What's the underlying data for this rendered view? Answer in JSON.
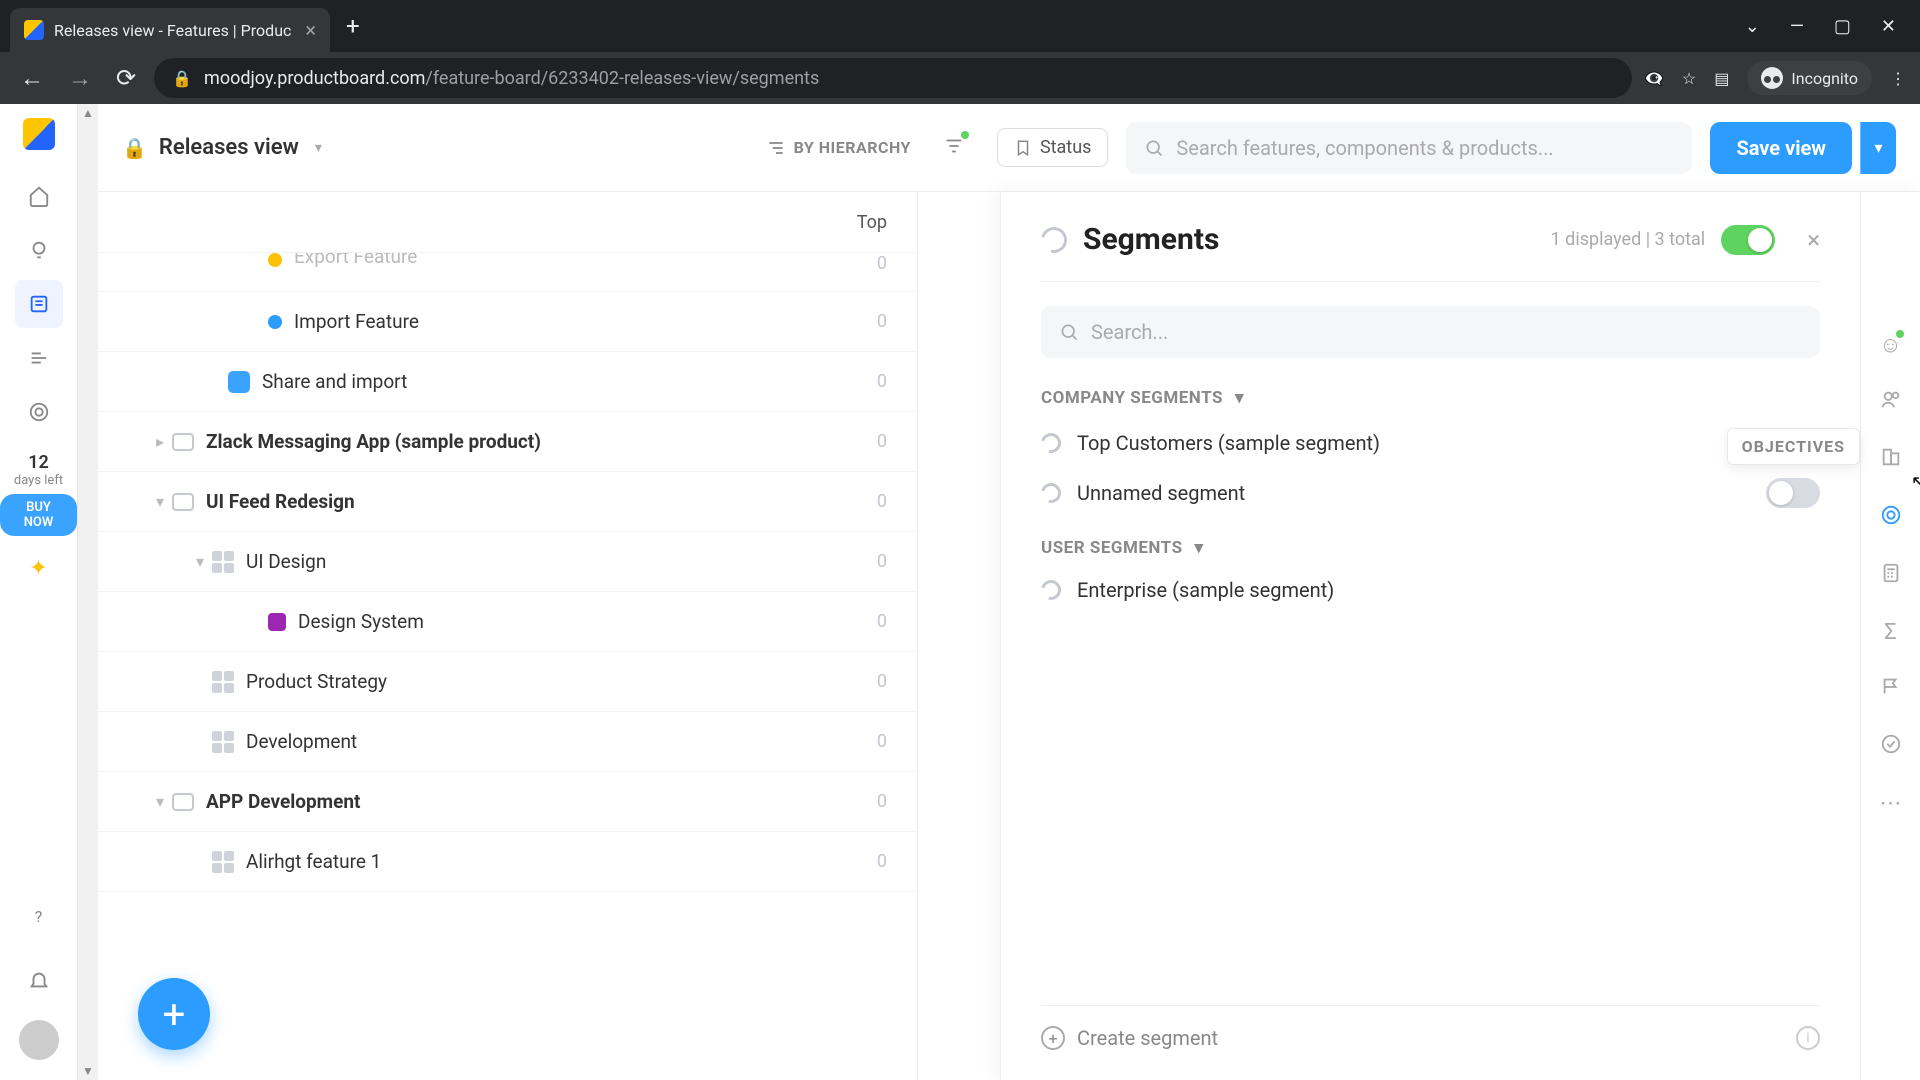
{
  "browser": {
    "tab_title": "Releases view - Features | Produc",
    "url_domain": "moodjoy.productboard.com",
    "url_path": "/feature-board/6233402-releases-view/segments",
    "incognito_label": "Incognito"
  },
  "topbar": {
    "view_name": "Releases view",
    "hierarchy_label": "BY HIERARCHY",
    "status_label": "Status",
    "search_placeholder": "Search features, components & products...",
    "save_label": "Save view"
  },
  "trial": {
    "days": "12",
    "label": "days left",
    "buy": "BUY NOW"
  },
  "column_header": "Top",
  "tree": {
    "export_feature": "Export Feature",
    "import_feature": "Import Feature",
    "share_import": "Share and import",
    "zlack": "Zlack Messaging App (sample product)",
    "ui_feed": "UI Feed Redesign",
    "ui_design": "UI Design",
    "design_system": "Design System",
    "product_strategy": "Product Strategy",
    "development": "Development",
    "app_dev": "APP Development",
    "alirhgt": "Alirhgt feature 1",
    "val": "0"
  },
  "panel": {
    "title": "Segments",
    "count": "1 displayed | 3 total",
    "search_placeholder": "Search...",
    "group_company": "COMPANY SEGMENTS",
    "group_user": "USER SEGMENTS",
    "top_customers": "Top Customers (sample segment)",
    "unnamed": "Unnamed segment",
    "enterprise": "Enterprise (sample segment)",
    "create": "Create segment"
  },
  "right_rail": {
    "tooltip": "OBJECTIVES"
  }
}
